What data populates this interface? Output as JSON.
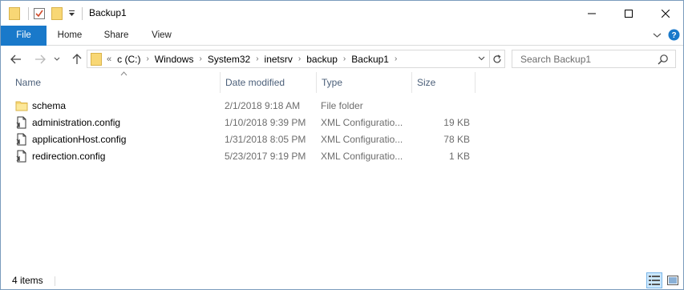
{
  "window": {
    "title": "Backup1"
  },
  "ribbon": {
    "tabs": [
      {
        "label": "File"
      },
      {
        "label": "Home"
      },
      {
        "label": "Share"
      },
      {
        "label": "View"
      }
    ]
  },
  "address": {
    "overflow": "«",
    "crumbs": [
      "c (C:)",
      "Windows",
      "System32",
      "inetsrv",
      "backup",
      "Backup1"
    ]
  },
  "search": {
    "placeholder": "Search Backup1"
  },
  "columns": {
    "name": "Name",
    "date": "Date modified",
    "type": "Type",
    "size": "Size"
  },
  "files": [
    {
      "name": "schema",
      "date": "2/1/2018 9:18 AM",
      "type": "File folder",
      "size": "",
      "icon": "folder-icon"
    },
    {
      "name": "administration.config",
      "date": "1/10/2018 9:39 PM",
      "type": "XML Configuratio...",
      "size": "19 KB",
      "icon": "config-file-icon"
    },
    {
      "name": "applicationHost.config",
      "date": "1/31/2018 8:05 PM",
      "type": "XML Configuratio...",
      "size": "78 KB",
      "icon": "config-file-icon"
    },
    {
      "name": "redirection.config",
      "date": "5/23/2017 9:19 PM",
      "type": "XML Configuratio...",
      "size": "1 KB",
      "icon": "config-file-icon"
    }
  ],
  "status": {
    "items": "4 items"
  },
  "colors": {
    "accent": "#1979ca",
    "folder": "#f8d775",
    "header_text": "#4c607a"
  }
}
